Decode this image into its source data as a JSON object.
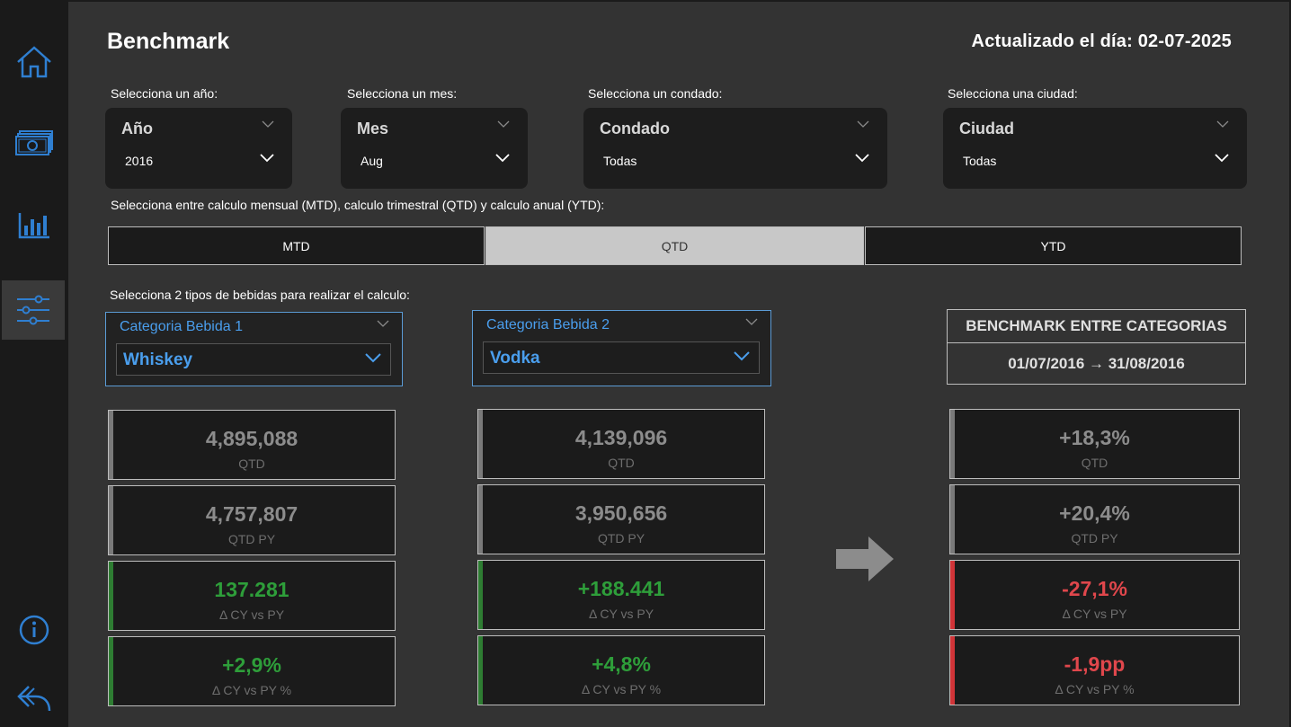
{
  "nav": {
    "items": [
      {
        "icon": "home-icon"
      },
      {
        "icon": "money-icon"
      },
      {
        "icon": "bar-chart-icon"
      },
      {
        "icon": "sliders-icon",
        "active": true
      }
    ],
    "bottom": [
      {
        "icon": "info-icon"
      },
      {
        "icon": "back-arrow-icon"
      }
    ]
  },
  "header": {
    "title": "Benchmark",
    "updated": "Actualizado el día: 02-07-2025"
  },
  "filters": {
    "year": {
      "label": "Selecciona un año:",
      "title": "Año",
      "value": "2016"
    },
    "month": {
      "label": "Selecciona un mes:",
      "title": "Mes",
      "value": "Aug"
    },
    "county": {
      "label": "Selecciona un condado:",
      "title": "Condado",
      "value": "Todas"
    },
    "city": {
      "label": "Selecciona una ciudad:",
      "title": "Ciudad",
      "value": "Todas"
    }
  },
  "period": {
    "label": "Selecciona entre calculo mensual (MTD), calculo trimestral (QTD) y calculo anual (YTD):",
    "options": [
      "MTD",
      "QTD",
      "YTD"
    ],
    "selected": "QTD"
  },
  "categories": {
    "label": "Selecciona 2 tipos de bebidas para realizar el calculo:",
    "cat1": {
      "title": "Categoria Bebida 1",
      "value": "Whiskey"
    },
    "cat2": {
      "title": "Categoria Bebida 2",
      "value": "Vodka"
    }
  },
  "benchmark": {
    "title": "BENCHMARK ENTRE CATEGORIAS",
    "range": "01/07/2016 → 31/08/2016"
  },
  "kpis": {
    "cat1": [
      {
        "value": "4,895,088",
        "label": "QTD"
      },
      {
        "value": "4,757,807",
        "label": "QTD PY"
      },
      {
        "value": "137.281",
        "label": "Δ CY vs PY"
      },
      {
        "value": "+2,9%",
        "label": "Δ CY vs PY %"
      }
    ],
    "cat2": [
      {
        "value": "4,139,096",
        "label": "QTD"
      },
      {
        "value": "3,950,656",
        "label": "QTD PY"
      },
      {
        "value": "+188.441",
        "label": "Δ CY vs PY"
      },
      {
        "value": "+4,8%",
        "label": "Δ CY vs PY %"
      }
    ],
    "compare": [
      {
        "value": "+18,3%",
        "label": "QTD"
      },
      {
        "value": "+20,4%",
        "label": "QTD PY"
      },
      {
        "value": "-27,1%",
        "label": "Δ CY vs PY"
      },
      {
        "value": "-1,9pp",
        "label": "Δ CY vs PY %"
      }
    ]
  },
  "colors": {
    "accent_blue": "#4a9eed",
    "positive": "#2e9e3a",
    "negative": "#e0474c",
    "neutral": "#8c8c8c"
  }
}
